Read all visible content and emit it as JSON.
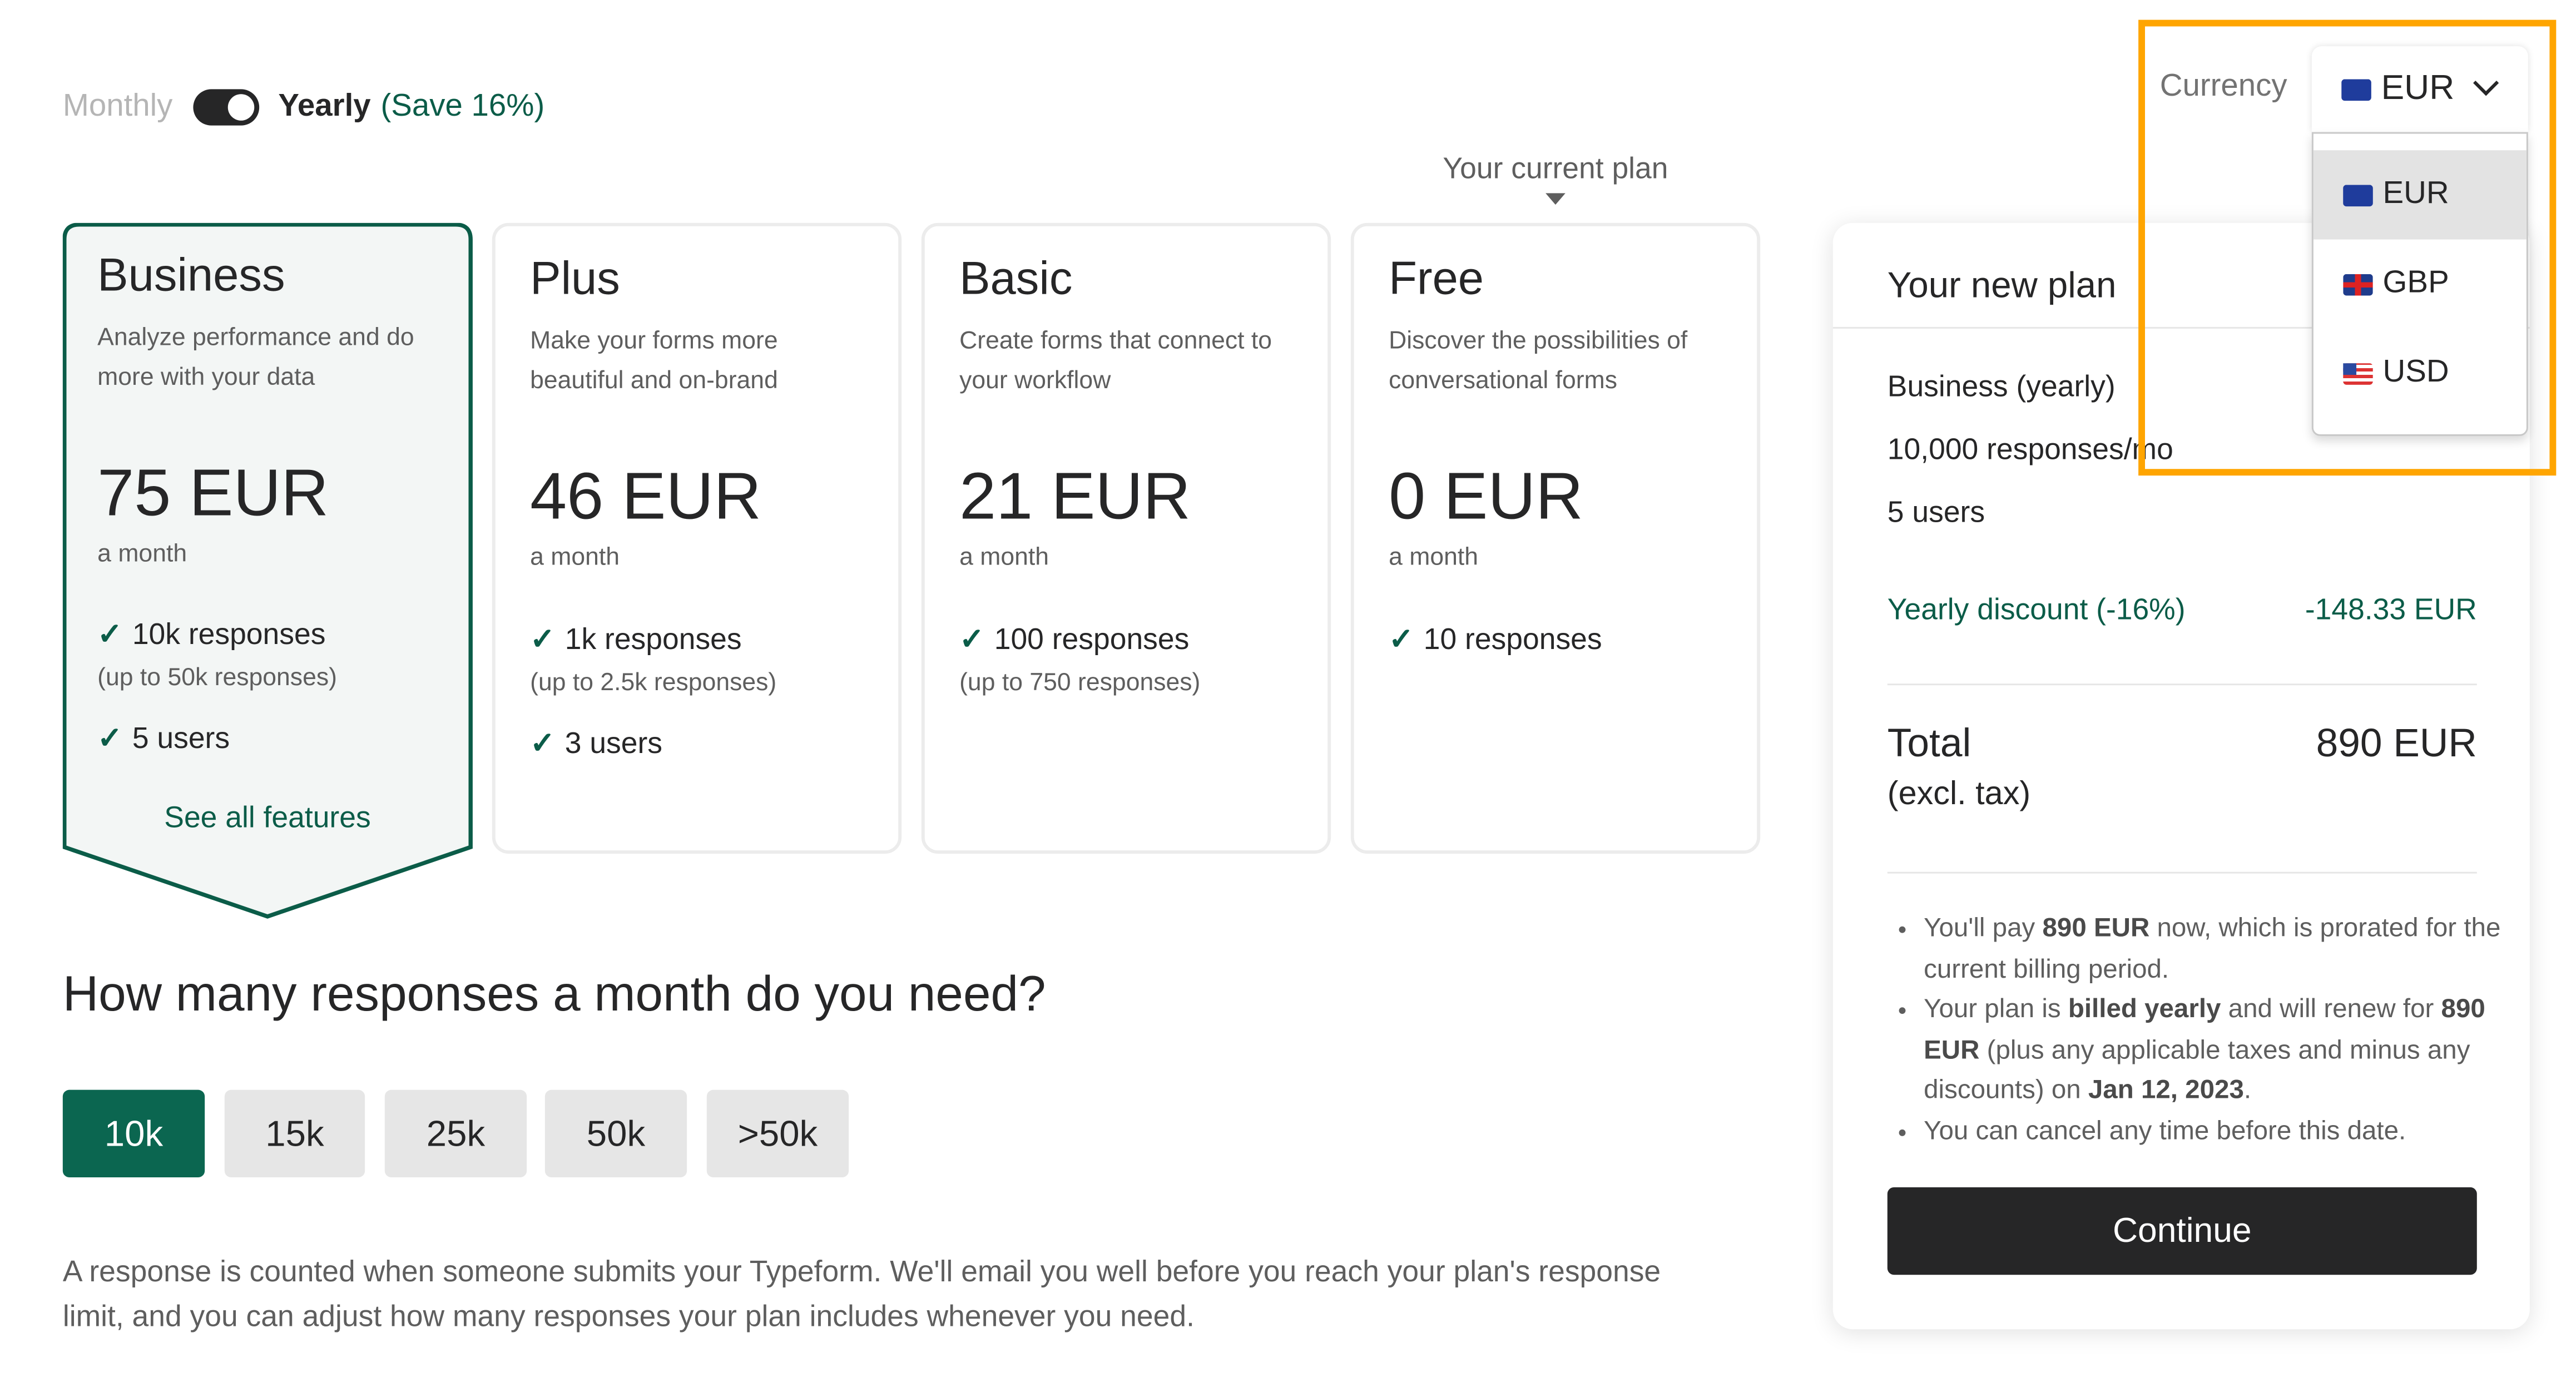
{
  "billing_toggle": {
    "monthly_label": "Monthly",
    "yearly_label": "Yearly",
    "save_label": "(Save 16%)",
    "selected": "Yearly"
  },
  "current_plan_label": "Your current plan",
  "plans": [
    {
      "name": "Business",
      "description": "Analyze performance and do more with your data",
      "price": "75 EUR",
      "period": "a month",
      "responses": "10k responses",
      "responses_sub": "(up to 50k responses)",
      "users": "5 users",
      "see_all": "See all features",
      "selected": true
    },
    {
      "name": "Plus",
      "description": "Make your forms more beautiful and on-brand",
      "price": "46 EUR",
      "period": "a month",
      "responses": "1k responses",
      "responses_sub": "(up to 2.5k responses)",
      "users": "3 users"
    },
    {
      "name": "Basic",
      "description": "Create forms that connect to your workflow",
      "price": "21 EUR",
      "period": "a month",
      "responses": "100 responses",
      "responses_sub": "(up to 750 responses)"
    },
    {
      "name": "Free",
      "description": "Discover the possibilities of conversational forms",
      "price": "0 EUR",
      "period": "a month",
      "responses": "10 responses",
      "current": true
    }
  ],
  "responses_question": "How many responses a month do you need?",
  "response_options": [
    {
      "label": "10k",
      "selected": true
    },
    {
      "label": "15k"
    },
    {
      "label": "25k"
    },
    {
      "label": "50k"
    },
    {
      "label": ">50k"
    }
  ],
  "footer_note": "A response is counted when someone submits your Typeform. We'll email you well before you reach your plan's response limit, and you can adjust how many responses your plan includes whenever you need.",
  "summary": {
    "title": "Your new plan",
    "plan_line": "Business (yearly)",
    "responses_line": "10,000 responses/mo",
    "users_line": "5 users",
    "discount_label": "Yearly discount (-16%)",
    "discount_value": "-148.33 EUR",
    "total_label": "Total",
    "total_sub": "(excl. tax)",
    "total_value": "890 EUR",
    "bullets": {
      "b1_pre": "You'll pay ",
      "b1_bold": "890 EUR",
      "b1_post": " now, which is prorated for the current billing period.",
      "b2_pre": "Your plan is ",
      "b2_bold1": "billed yearly",
      "b2_mid": " and will renew for ",
      "b2_bold2": "890 EUR",
      "b2_mid2": " (plus any applicable taxes and minus any discounts) on ",
      "b2_bold3": "Jan 12, 2023",
      "b2_post": ".",
      "b3": "You can cancel any time before this date."
    },
    "continue_label": "Continue"
  },
  "currency": {
    "label": "Currency",
    "selected": "EUR",
    "options": [
      {
        "code": "EUR",
        "flag": "eu-flag-icon"
      },
      {
        "code": "GBP",
        "flag": "gb-flag-icon"
      },
      {
        "code": "USD",
        "flag": "us-flag-icon"
      }
    ]
  },
  "colors": {
    "accent": "#0b5c48",
    "highlight": "#ffa500",
    "button_dark": "#262627"
  }
}
